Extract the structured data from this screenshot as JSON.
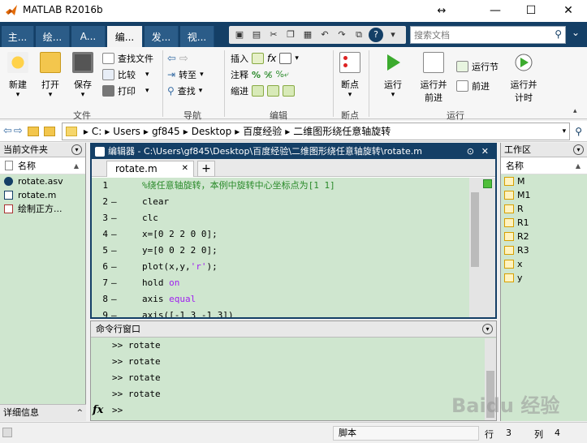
{
  "window": {
    "title": "MATLAB R2016b",
    "controls": {
      "minimize": "—",
      "maximize": "☐",
      "close": "✕",
      "resize": "↔"
    }
  },
  "tabs": [
    {
      "label": "主..."
    },
    {
      "label": "绘..."
    },
    {
      "label": "A..."
    },
    {
      "label": "编..."
    },
    {
      "label": "发..."
    },
    {
      "label": "视..."
    }
  ],
  "search": {
    "placeholder": "搜索文档",
    "help": "?"
  },
  "ribbon": {
    "file": {
      "new": "新建",
      "open": "打开",
      "save": "保存",
      "find_files": "查找文件",
      "compare": "比较",
      "print": "打印",
      "group_label": "文件"
    },
    "navigate": {
      "goto": "转至",
      "find": "查找",
      "group_label": "导航"
    },
    "edit": {
      "insert": "插入",
      "comment": "注释",
      "indent": "缩进",
      "fx": "fx",
      "group_label": "编辑"
    },
    "breakpoints": {
      "label": "断点",
      "group_label": "断点"
    },
    "run": {
      "run": "运行",
      "run_advance": "运行并\n前进",
      "run_section": "运行节",
      "advance": "前进",
      "run_time": "运行并\n计时",
      "group_label": "运行"
    }
  },
  "address": {
    "crumbs": [
      "C:",
      "Users",
      "gf845",
      "Desktop",
      "百度经验",
      "二维图形绕任意轴旋转"
    ],
    "sep": "▸"
  },
  "current_folder": {
    "title": "当前文件夹",
    "column": "名称",
    "sort_arrow": "▲",
    "files": [
      {
        "name": "rotate.asv"
      },
      {
        "name": "rotate.m"
      },
      {
        "name": "绘制正方..."
      }
    ],
    "details": "详细信息"
  },
  "editor": {
    "title": "编辑器 - C:\\Users\\gf845\\Desktop\\百度经验\\二维图形绕任意轴旋转\\rotate.m",
    "tab_label": "rotate.m",
    "add_tab": "+",
    "lines": [
      {
        "n": "1",
        "dash": "",
        "code": "%绕任意轴旋转，本例中旋转中心坐标点为[1 1]"
      },
      {
        "n": "2",
        "dash": "—",
        "code": "clear"
      },
      {
        "n": "3",
        "dash": "—",
        "code": "clc"
      },
      {
        "n": "4",
        "dash": "—",
        "code": "x=[0 2 2 0 0];"
      },
      {
        "n": "5",
        "dash": "—",
        "code": "y=[0 0 2 2 0];"
      },
      {
        "n": "6",
        "dash": "—",
        "code_pre": "plot(x,y,",
        "code_str": "'r'",
        "code_post": ");"
      },
      {
        "n": "7",
        "dash": "—",
        "code_pre": "hold ",
        "code_kw": "on"
      },
      {
        "n": "8",
        "dash": "—",
        "code_pre": "axis ",
        "code_kw": "equal"
      },
      {
        "n": "9",
        "dash": "—",
        "code": "axis([-1 3 -1 3])"
      }
    ]
  },
  "command_window": {
    "title": "命令行窗口",
    "lines": [
      ">> rotate",
      ">> rotate",
      ">> rotate",
      ">> rotate"
    ],
    "prompt": ">>",
    "fx": "fx"
  },
  "workspace": {
    "title": "工作区",
    "column": "名称",
    "sort_arrow": "▲",
    "vars": [
      "M",
      "M1",
      "R",
      "R1",
      "R2",
      "R3",
      "x",
      "y"
    ]
  },
  "status": {
    "mode": "脚本",
    "row_label": "行",
    "row": "3",
    "col_label": "列",
    "col": "4"
  },
  "watermark": "Baidu 经验"
}
